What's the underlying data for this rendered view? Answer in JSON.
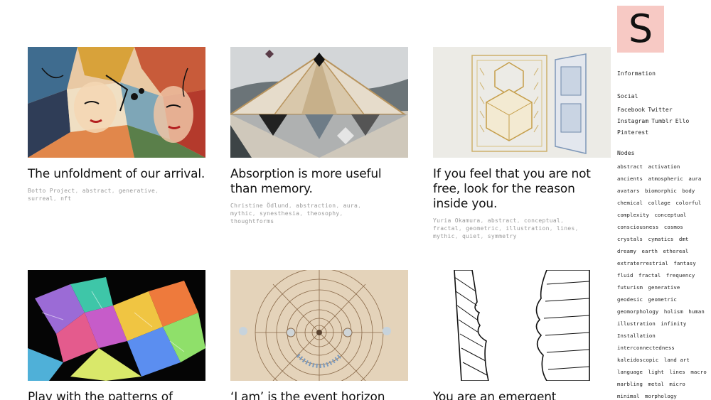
{
  "posts": [
    {
      "title": "The unfoldment of our arrival.",
      "tags": [
        "Botto Project",
        "abstract",
        "generative",
        "surreal",
        "nft"
      ]
    },
    {
      "title": "Absorption is more useful than memory.",
      "tags": [
        "Christine Ödlund",
        "abstraction",
        "aura",
        "mythic",
        "synesthesia",
        "theosophy",
        "thoughtforms"
      ]
    },
    {
      "title": "If you feel that you are not free, look for the reason inside you.",
      "tags": [
        "Yuria Okamura",
        "abstract",
        "conceptual",
        "fractal",
        "geometric",
        "illustration",
        "lines",
        "mythic",
        "quiet",
        "symmetry"
      ]
    },
    {
      "title": "Play with the patterns of",
      "tags": []
    },
    {
      "title": "‘I am’ is the event horizon",
      "tags": []
    },
    {
      "title": "You are an emergent",
      "tags": []
    }
  ],
  "sidebar": {
    "logo": "S",
    "information": "Information",
    "social_heading": "Social",
    "social_links": [
      "Facebook",
      "Twitter",
      "Instagram",
      "Tumblr",
      "Ello",
      "Pinterest"
    ],
    "nodes_heading": "Nodes",
    "nodes": [
      "abstract",
      "activation",
      "ancients",
      "atmospheric",
      "aura",
      "avatars",
      "biomorphic",
      "body",
      "chemical",
      "collage",
      "colorful",
      "complexity",
      "conceptual",
      "consciousness",
      "cosmos",
      "crystals",
      "cymatics",
      "dmt",
      "dreamy",
      "earth",
      "ethereal",
      "extraterrestrial",
      "fantasy",
      "fluid",
      "fractal",
      "frequency",
      "futurism",
      "generative",
      "geodesic",
      "geometric",
      "geomorphology",
      "holism",
      "human",
      "illustration",
      "infinity",
      "Installation",
      "interconnectedness",
      "kaleidoscopic",
      "land art",
      "language",
      "light",
      "lines",
      "macro",
      "marbling",
      "metal",
      "micro",
      "minimal",
      "morphology"
    ]
  },
  "colors": {
    "logo_bg": "#f7c9c4",
    "tag_text": "#999999"
  }
}
